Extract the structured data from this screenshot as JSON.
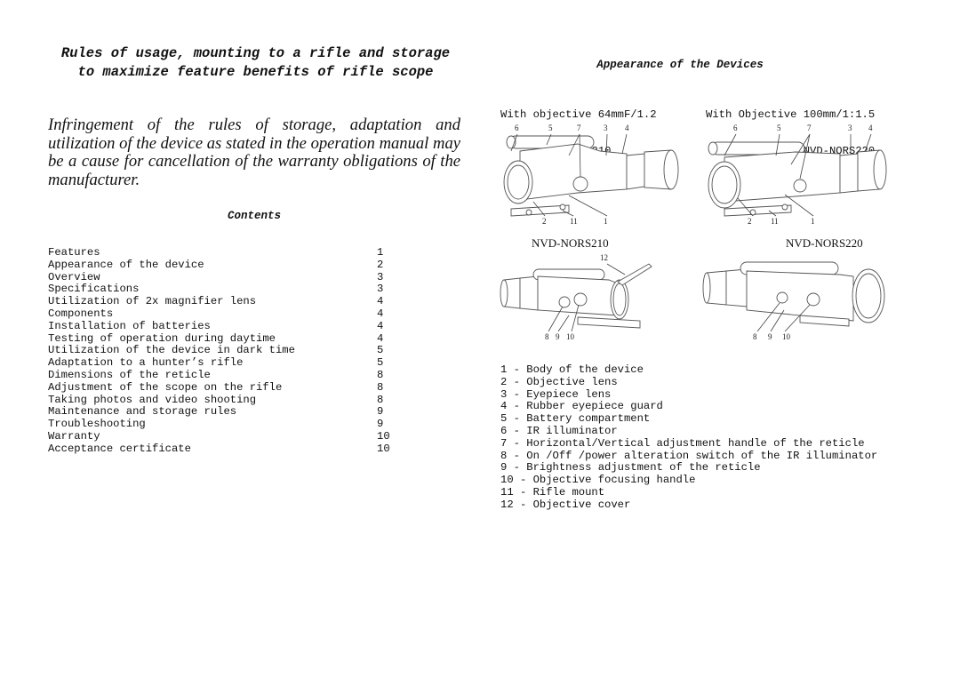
{
  "left_page": {
    "title": "Rules of usage, mounting to a rifle and storage to maximize feature benefits of rifle scope",
    "intro": "Infringement of the rules of storage, adaptation and utilization of the device as stated in the operation manual may be a cause for cancellation of the warranty obligations of the manufacturer.",
    "contents_title": "Contents",
    "toc": [
      {
        "label": "Features",
        "page": "1"
      },
      {
        "label": "Appearance of the device",
        "page": "2"
      },
      {
        "label": "Overview",
        "page": "3"
      },
      {
        "label": "Specifications",
        "page": "3"
      },
      {
        "label": "Utilization of 2x magnifier lens",
        "page": "4"
      },
      {
        "label": "Components",
        "page": "4"
      },
      {
        "label": "Installation of batteries",
        "page": "4"
      },
      {
        "label": "Testing of operation during daytime",
        "page": "4"
      },
      {
        "label": "Utilization of the device in dark time",
        "page": "5"
      },
      {
        "label": "Adaptation to a hunter’s rifle",
        "page": "5"
      },
      {
        "label": "Dimensions of the reticle",
        "page": "8"
      },
      {
        "label": "Adjustment of the scope on the rifle",
        "page": "8"
      },
      {
        "label": "Taking photos and video shooting",
        "page": "8"
      },
      {
        "label": "Maintenance and storage rules",
        "page": "9"
      },
      {
        "label": "Troubleshooting",
        "page": "9"
      },
      {
        "label": "Warranty",
        "page": "10"
      },
      {
        "label": "Acceptance certificate",
        "page": "10"
      }
    ]
  },
  "right_page": {
    "title": "Appearance of the Devices",
    "variants": [
      {
        "objective": "With objective 64mmF/1.2",
        "model": "NVD-NORS210"
      },
      {
        "objective": "With Objective 100mm/1:1.5",
        "model": "NVD-NORS220"
      }
    ],
    "figures": {
      "front_left": {
        "callouts_top": [
          "6",
          "5",
          "7",
          "3",
          "4"
        ],
        "callouts_bottom": [
          "2",
          "11",
          "1"
        ]
      },
      "front_right": {
        "callouts_top": [
          "6",
          "5",
          "7",
          "3",
          "4"
        ],
        "callouts_bottom": [
          "2",
          "11",
          "1"
        ]
      },
      "back_left": {
        "caption": "NVD-NORS210",
        "callouts_top": [
          "12"
        ],
        "callouts_bottom": [
          "8",
          "9",
          "10"
        ]
      },
      "back_right": {
        "caption": "NVD-NORS220",
        "callouts_bottom": [
          "8",
          "9",
          "10"
        ]
      }
    },
    "legend": [
      "1 - Body of the device",
      "2 - Objective lens",
      "3 - Eyepiece lens",
      "4 - Rubber eyepiece guard",
      "5 - Battery compartment",
      "6 - IR illuminator",
      "7 - Horizontal/Vertical adjustment handle of the reticle",
      "8 - On /Off /power alteration switch of the IR illuminator",
      "9 - Brightness adjustment of the reticle",
      "10 - Objective focusing handle",
      "11 - Rifle mount",
      "12 - Objective cover"
    ]
  }
}
